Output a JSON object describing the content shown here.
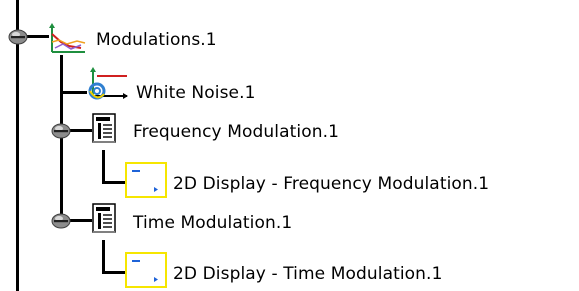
{
  "tree": {
    "root": {
      "label": "Modulations.1",
      "icon": "modulation-set-icon",
      "expanded": true,
      "children": [
        {
          "label": "White Noise.1",
          "icon": "white-noise-icon"
        },
        {
          "label": "Frequency Modulation.1",
          "icon": "document-icon",
          "expanded": true,
          "children": [
            {
              "label": "2D Display - Frequency Modulation.1",
              "icon": "2d-display-icon"
            }
          ]
        },
        {
          "label": "Time Modulation.1",
          "icon": "document-icon",
          "expanded": true,
          "children": [
            {
              "label": "2D Display - Time Modulation.1",
              "icon": "2d-display-icon"
            }
          ]
        }
      ]
    }
  },
  "colors": {
    "tree_line": "#000000",
    "display_icon_border": "#f6e600",
    "display_icon_mark": "#1e63d8",
    "noise_spiral": "#2f7fd0",
    "noise_accent": "#f0d000",
    "axis_red": "#d02020",
    "axis_green": "#1f8f3f"
  }
}
